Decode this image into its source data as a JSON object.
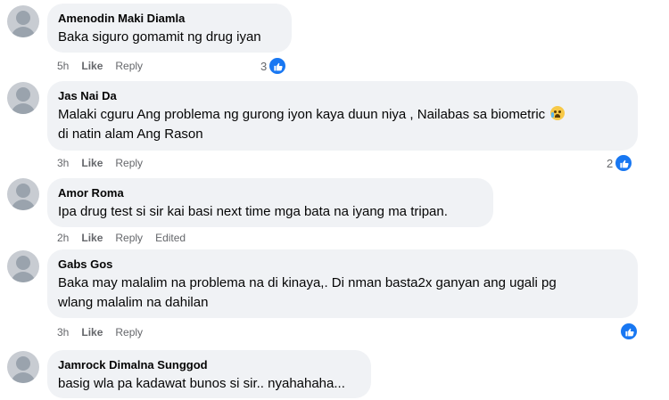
{
  "comments": [
    {
      "name": "Amenodin Maki Diamla",
      "text": "Baka siguro gomamit ng drug iyan",
      "time": "5h",
      "like": "Like",
      "reply": "Reply",
      "reactions": "3"
    },
    {
      "name": "Jas Nai Da",
      "text_line1": "Malaki cguru Ang problema ng gurong iyon kaya duun niya , Nailabas sa biometric",
      "emoji": "crying-face",
      "text_line2": "di natin alam Ang Rason",
      "time": "3h",
      "like": "Like",
      "reply": "Reply",
      "reactions": "2"
    },
    {
      "name": "Amor Roma",
      "text": "Ipa drug test si sir kai basi next time mga bata na iyang ma tripan.",
      "time": "2h",
      "like": "Like",
      "reply": "Reply",
      "edited": "Edited"
    },
    {
      "name": "Gabs Gos",
      "text_line1": "Baka may malalim na problema na di kinaya,. Di nman basta2x ganyan ang ugali pg",
      "text_line2": "wlang malalim na dahilan",
      "time": "3h",
      "like": "Like",
      "reply": "Reply"
    },
    {
      "name": "Jamrock Dimalna Sunggod",
      "text": "basig wla pa kadawat bunos si sir.. nyahahaha..."
    }
  ],
  "colors": {
    "bubble": "#f0f2f5",
    "like_blue": "#1877f2",
    "meta": "#65676b"
  }
}
